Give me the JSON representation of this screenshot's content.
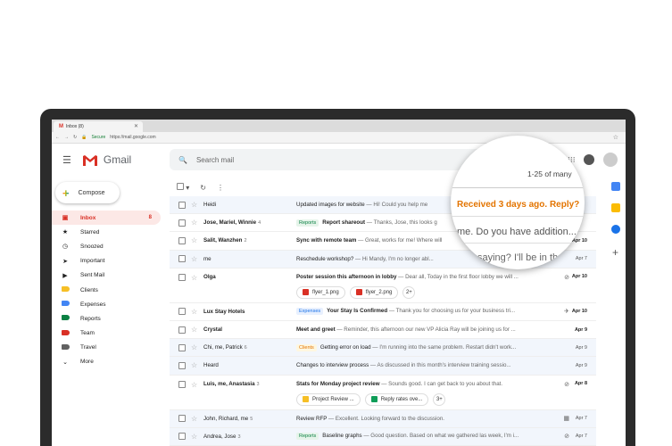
{
  "browser": {
    "tab_title": "Inbox (8)",
    "secure_label": "Secure",
    "url": "https://mail.google.com"
  },
  "header": {
    "app_name": "Gmail",
    "search_placeholder": "Search mail"
  },
  "compose_label": "Compose",
  "sidebar": {
    "items": [
      {
        "label": "Inbox",
        "count": "8"
      },
      {
        "label": "Starred"
      },
      {
        "label": "Snoozed"
      },
      {
        "label": "Important"
      },
      {
        "label": "Sent Mail"
      },
      {
        "label": "Clients",
        "color": "#f6bf26"
      },
      {
        "label": "Expenses",
        "color": "#4285f4"
      },
      {
        "label": "Reports",
        "color": "#0b8043"
      },
      {
        "label": "Team",
        "color": "#d93025"
      },
      {
        "label": "Travel",
        "color": "#616161"
      },
      {
        "label": "More"
      }
    ]
  },
  "magnifier": {
    "count": "1-25 of many",
    "nudge": "Received 3 days ago. Reply?",
    "preview": "me. Do you have addition...",
    "preview2": "saying? I'll be in th"
  },
  "emails": [
    {
      "sender": "Heidi",
      "subject": "Updated images for website",
      "snippet": " — Hi! Could you help me",
      "date": ""
    },
    {
      "sender": "Jose, Mariel, Winnie",
      "n": "4",
      "badge": "Reports",
      "subject": "Report shareout",
      "snippet": " — Thanks, Jose, this looks g",
      "date": ""
    },
    {
      "sender": "Salit, Wanzhen",
      "n": "2",
      "subject": "Sync with remote team",
      "snippet": " — Great, works for me! Where will",
      "date": "Apr 10"
    },
    {
      "sender": "me",
      "subject": "Reschedule workshop?",
      "snippet": " — Hi Mandy, I'm no longer abl...",
      "date": "Apr 7"
    },
    {
      "sender": "Olga",
      "subject": "Poster session this afternoon in lobby",
      "snippet": " — Dear all, Today in the first floor lobby we will ...",
      "date": "Apr 10",
      "chips": [
        "flyer_1.png",
        "flyer_2.png",
        "2+"
      ]
    },
    {
      "sender": "Lux Stay Hotels",
      "badge": "Expenses",
      "subject": "Your Stay Is Confirmed",
      "snippet": " — Thank you for choosing us for your business tri...",
      "date": "Apr 10"
    },
    {
      "sender": "Crystal",
      "subject": "Meet and greet",
      "snippet": " — Reminder, this afternoon our new VP Alicia Ray will be joining us for ...",
      "date": "Apr 9"
    },
    {
      "sender": "Chi, me, Patrick",
      "n": "6",
      "badge": "Clients",
      "subject": "Getting error on load",
      "snippet": " — I'm running into the same problem. Restart didn't work...",
      "date": "Apr 9"
    },
    {
      "sender": "Heard",
      "subject": "Changes to interview process",
      "snippet": " — As discussed in this month's interview training sessio...",
      "date": "Apr 9"
    },
    {
      "sender": "Luis, me, Anastasia",
      "n": "3",
      "subject": "Stats for Monday project review",
      "snippet": " — Sounds good. I can get back to you about that.",
      "date": "Apr 8",
      "chips": [
        "Project Review ...",
        "Reply rates ove...",
        "3+"
      ]
    },
    {
      "sender": "John, Richard, me",
      "n": "5",
      "subject": "Review RFP",
      "snippet": " — Excellent. Looking forward to the discussion.",
      "date": "Apr 7"
    },
    {
      "sender": "Andrea, Jose",
      "n": "3",
      "badge": "Reports",
      "subject": "Baseline graphs",
      "snippet": " — Good question. Based on what we gathered las week, I'm i...",
      "date": "Apr 7"
    }
  ]
}
